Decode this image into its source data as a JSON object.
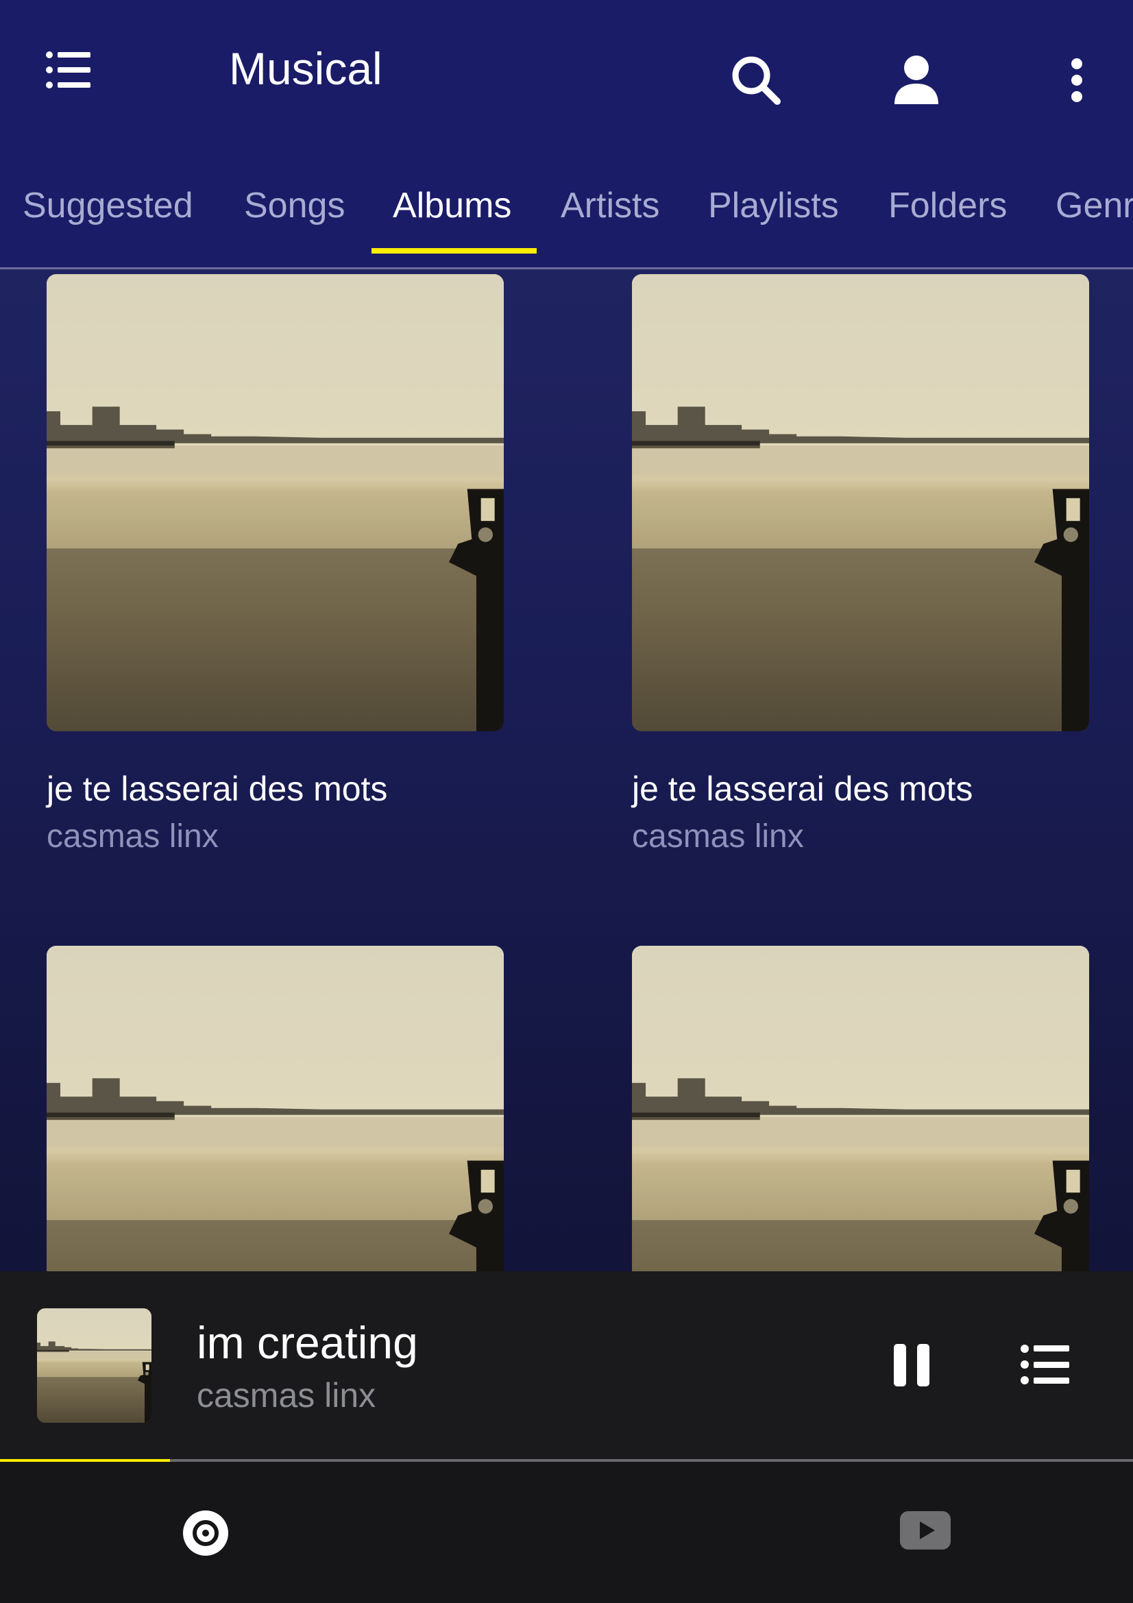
{
  "app": {
    "title": "Musical"
  },
  "tabs": [
    "Suggested",
    "Songs",
    "Albums",
    "Artists",
    "Playlists",
    "Folders",
    "Genres"
  ],
  "active_tab": "Albums",
  "albums": [
    {
      "title": "je te lasserai des mots",
      "artist": "casmas linx"
    },
    {
      "title": "je te lasserai des mots",
      "artist": "casmas linx"
    },
    {
      "title": "",
      "artist": ""
    },
    {
      "title": "",
      "artist": ""
    }
  ],
  "now_playing": {
    "title": "im creating",
    "artist": "casmas linx",
    "progress_fraction": 0.15
  },
  "colors": {
    "appbar": "#1a1c68",
    "accent": "#ffee00",
    "player_bg": "#1a1a1c"
  },
  "icons": {
    "menu": "menu-list-icon",
    "search": "search-icon",
    "account": "account-icon",
    "more": "more-vert-icon",
    "pause": "pause-icon",
    "queue": "queue-list-icon",
    "local_music": "disc-icon",
    "youtube": "youtube-icon"
  }
}
